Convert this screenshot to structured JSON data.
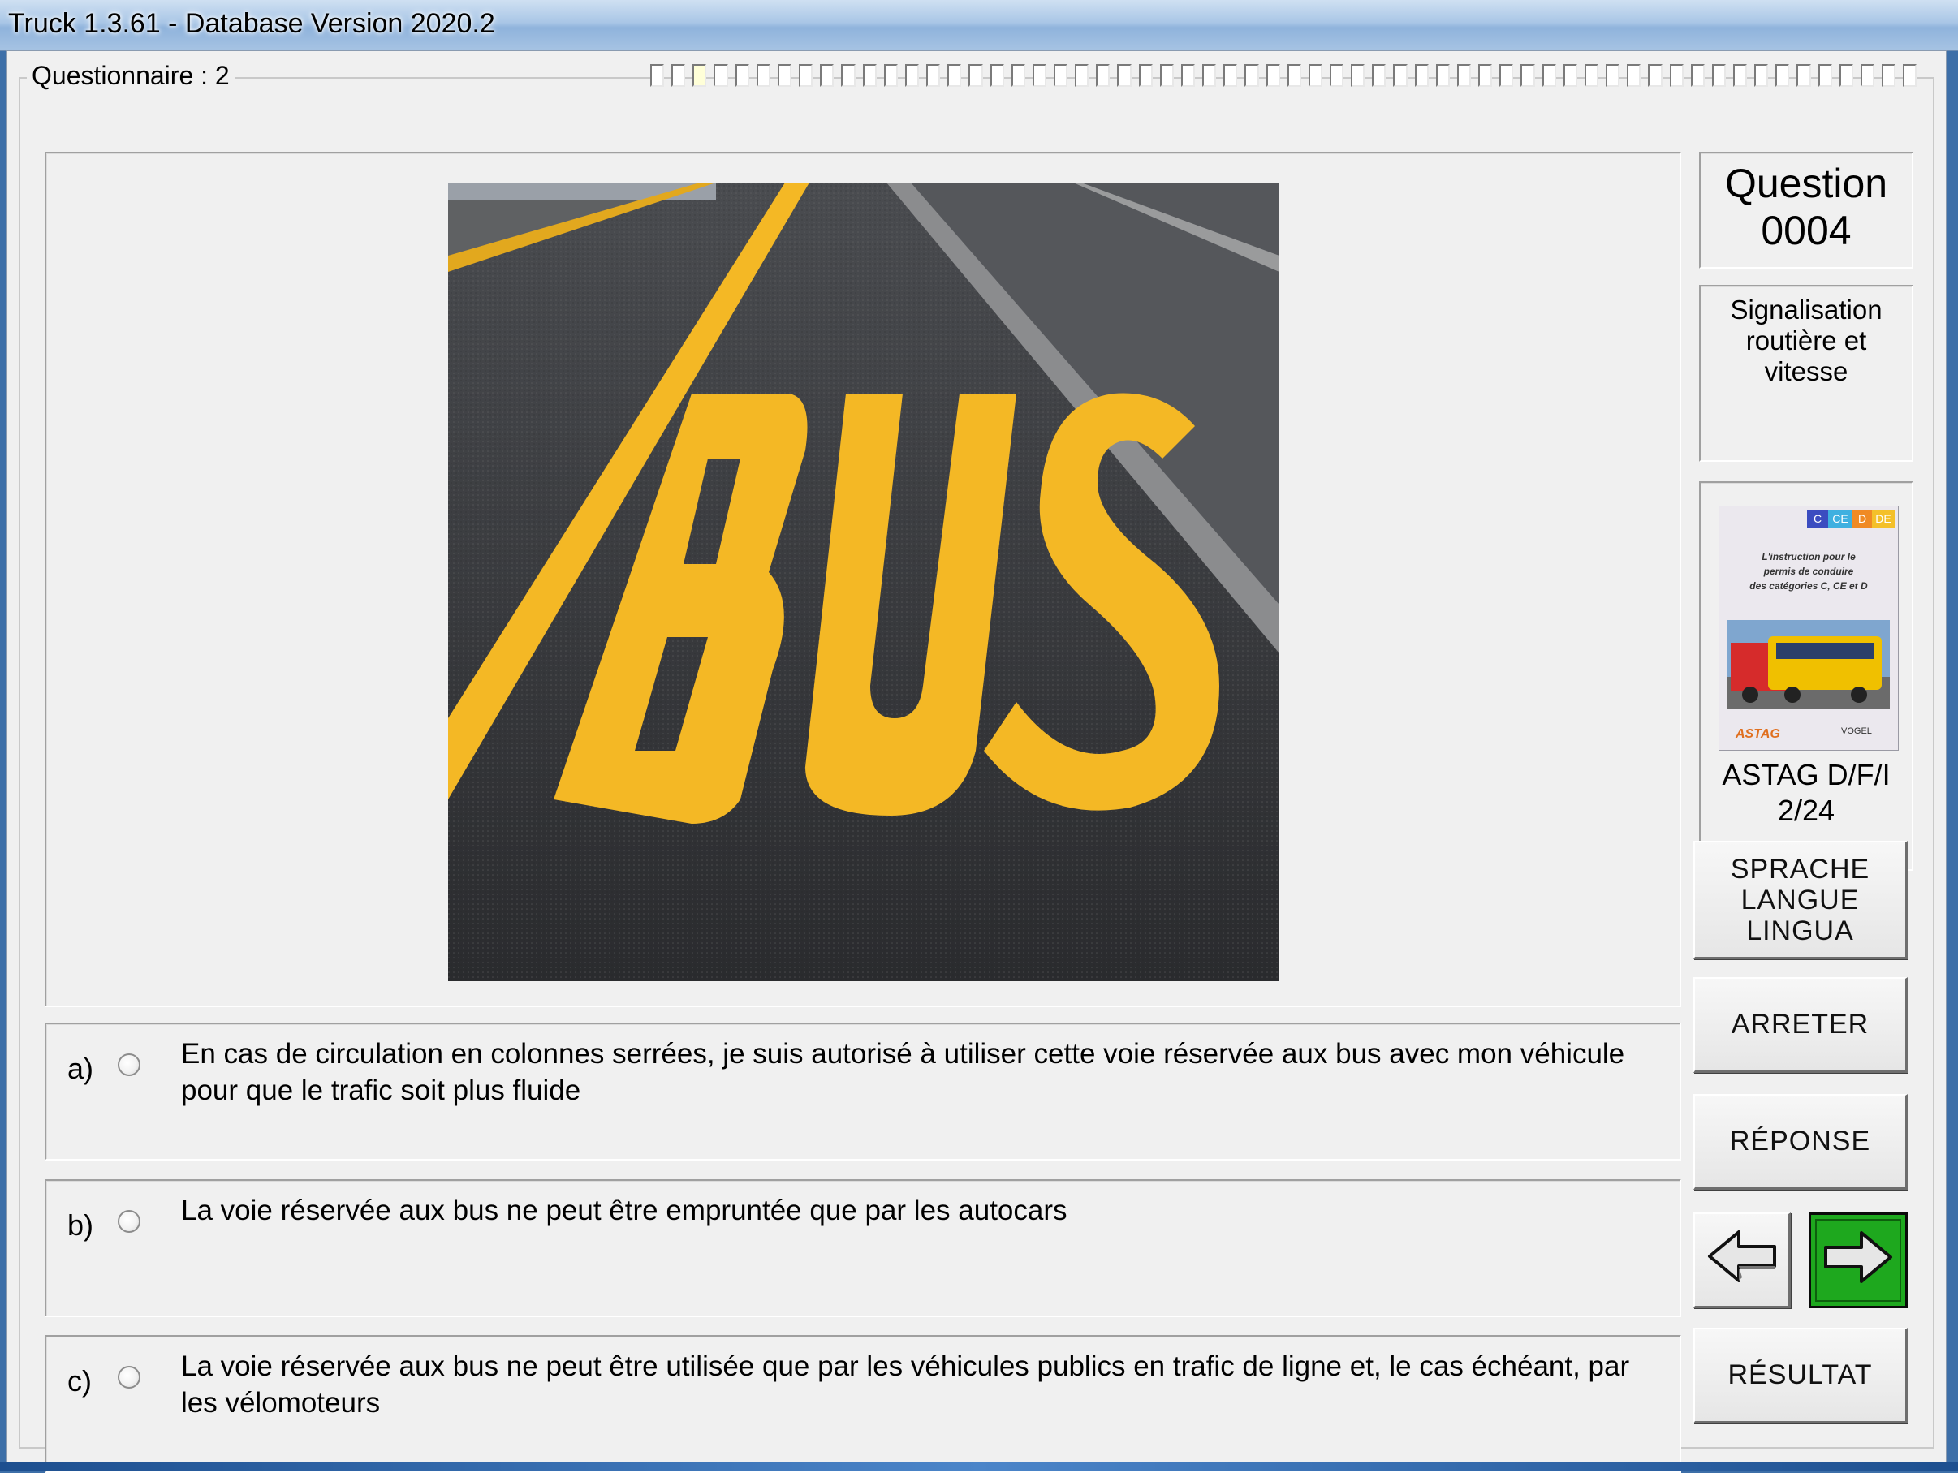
{
  "window": {
    "title": "Truck 1.3.61 - Database Version 2020.2"
  },
  "questionnaire": {
    "label": "Questionnaire : 2",
    "progress_total": 60,
    "progress_current": 3
  },
  "question": {
    "label": "Question",
    "number": "0004",
    "category_line1": "Signalisation",
    "category_line2": "routière et vitesse",
    "image_road_text": "BUS"
  },
  "book": {
    "badges": [
      "C",
      "CE",
      "D",
      "DE"
    ],
    "cover_text_1": "L'instruction pour le",
    "cover_text_2": "permis de conduire",
    "cover_text_3": "des catégories C, CE et D",
    "publisher_left": "ASTAG",
    "publisher_right": "VOGEL",
    "source_line1": "ASTAG D/F/I",
    "source_line2": "2/24"
  },
  "answers": [
    {
      "letter": "a)",
      "text": "En cas de circulation en colonnes serrées, je suis autorisé à utiliser cette voie réservée aux bus avec mon véhicule pour que le trafic soit plus fluide",
      "selected": false
    },
    {
      "letter": "b)",
      "text": "La voie réservée aux bus ne peut être empruntée que par les autocars",
      "selected": false
    },
    {
      "letter": "c)",
      "text": "La voie réservée aux bus ne peut être utilisée que par les véhicules publics en trafic de ligne et, le cas échéant, par les vélomoteurs",
      "selected": false
    }
  ],
  "buttons": {
    "lang_line1": "SPRACHE",
    "lang_line2": "LANGUE",
    "lang_line3": "LINGUA",
    "stop": "ARRETER",
    "response": "RÉPONSE",
    "result": "RÉSULTAT"
  },
  "colors": {
    "next_button": "#1ea81e",
    "road_marking": "#f4b825",
    "progress_current": "#ffffd8"
  },
  "icons": {
    "prev": "arrow-left-icon",
    "next": "arrow-right-icon"
  }
}
